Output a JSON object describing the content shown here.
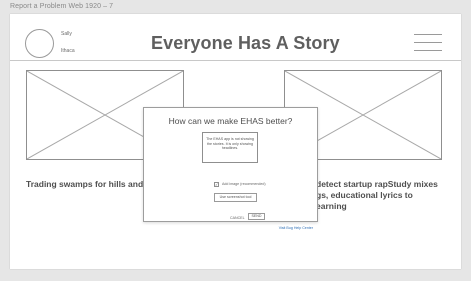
{
  "frame": {
    "title": "Report a Problem Web 1920 – 7"
  },
  "header": {
    "user_name": "Sally",
    "user_location": "Ithaca",
    "title": "Everyone Has A Story",
    "menu_icon": "hamburger-menu-icon"
  },
  "cards": [
    {
      "title": "Trading swamps for hills and",
      "image_icon": "image-placeholder-icon"
    },
    {
      "title": "detect startup rapStudy mixes\ngs, educational lyrics to\nearning",
      "image_icon": "image-placeholder-icon"
    }
  ],
  "modal": {
    "title": "How can we make EHAS better?",
    "feedback_text": "The EHAS app is not showing the stories. It is only showing headlines.",
    "attach_checked": true,
    "attach_label": "Add image (recommended)",
    "screenshot_button": "Use screenshot tool",
    "cancel_label": "CANCEL",
    "send_label": "SEND",
    "help_link": "Visit Bug Help Center"
  },
  "colors": {
    "background": "#e6e6e6",
    "link": "#2f6fb5",
    "text": "#4f4f4f"
  }
}
